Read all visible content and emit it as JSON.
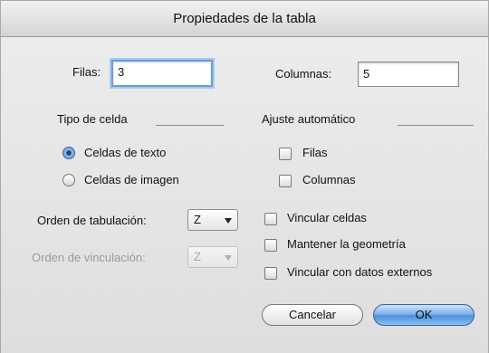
{
  "dialog": {
    "title": "Propiedades de la tabla"
  },
  "rows_field": {
    "label": "Filas:",
    "value": "3"
  },
  "columns_field": {
    "label": "Columnas:",
    "value": "5"
  },
  "cell_type": {
    "heading": "Tipo de celda",
    "options": [
      {
        "label": "Celdas de texto",
        "selected": true
      },
      {
        "label": "Celdas de imagen",
        "selected": false
      }
    ]
  },
  "auto_fit": {
    "heading": "Ajuste automático",
    "options": [
      {
        "label": "Filas",
        "checked": false
      },
      {
        "label": "Columnas",
        "checked": false
      }
    ]
  },
  "tab_order": {
    "label": "Orden de tabulación:",
    "value": "Z",
    "icon": "chevron-down-icon"
  },
  "link_order": {
    "label": "Orden de vinculación:",
    "value": "Z",
    "icon": "chevron-down-icon",
    "disabled": true
  },
  "options": [
    {
      "label": "Vincular celdas",
      "checked": false
    },
    {
      "label": "Mantener la geometría",
      "checked": false
    },
    {
      "label": "Vincular con datos externos",
      "checked": false
    }
  ],
  "buttons": {
    "cancel_label": "Cancelar",
    "ok_label": "OK"
  },
  "colors": {
    "ok_button": "#5a95dc",
    "focus_ring": "#a9c9ee",
    "radio_selected": "#5a8ed0"
  }
}
